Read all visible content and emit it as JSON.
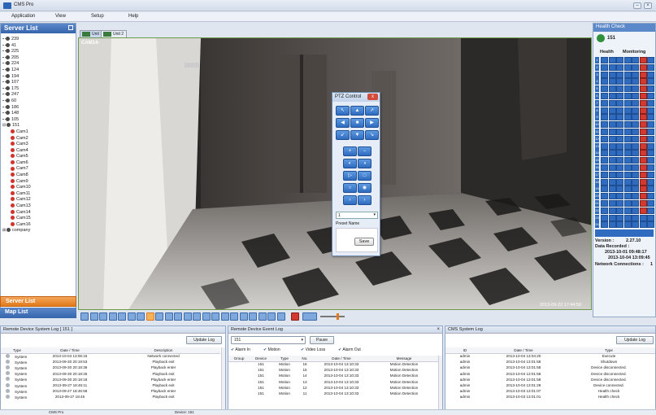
{
  "window": {
    "title": "CMS Pro"
  },
  "menu": [
    "Application",
    "View",
    "Setup",
    "Help"
  ],
  "server_panel": {
    "title": "Server List",
    "servers_top": [
      "239",
      "41",
      "225",
      "205",
      "224",
      "124",
      "194",
      "107",
      "175",
      "247",
      "60",
      "186",
      "148",
      "105"
    ],
    "open_server": "151",
    "cameras": [
      "Cam1",
      "Cam2",
      "Cam3",
      "Cam4",
      "Cam5",
      "Cam6",
      "Cam7",
      "Cam8",
      "Cam9",
      "Cam10",
      "Cam11",
      "Cam12",
      "Cam13",
      "Cam14",
      "Cam15",
      "Cam16"
    ],
    "group": "company",
    "bottom_tabs": {
      "server_list": "Server List",
      "map_list": "Map List"
    }
  },
  "video": {
    "tabs": [
      "Unit 1",
      "Unit 2"
    ],
    "camera_label": "CAM14-",
    "timestamp": "2013-09-22 17:44:59"
  },
  "ptz": {
    "title": "PTZ Control",
    "close": "x",
    "select_value": "1",
    "preset_label": "Preset Name",
    "save_label": "Save"
  },
  "health": {
    "title": "Health Check",
    "unit": "151",
    "columns": [
      "Health",
      "Monitoring"
    ],
    "version_label": "Version :",
    "version": "2.27.10",
    "data_recorded_label": "Data Recorded :",
    "data_recorded_from": "2013-10-01 09:48:17",
    "data_recorded_to": "2013-10-04 13:09:45",
    "network_label": "Network Connections :",
    "network_value": "1"
  },
  "device_log": {
    "title": "Remote Device System Log [ 151 ]",
    "button": "Update Log",
    "columns": [
      "Type",
      "Date / Time",
      "Description"
    ],
    "rows": [
      [
        "System",
        "2013-10-04 13:06:15",
        "Network connected"
      ],
      [
        "System",
        "2013-09-30 20:19:53",
        "Playback exit"
      ],
      [
        "System",
        "2013-09-30 20:18:36",
        "Playback enter"
      ],
      [
        "System",
        "2013-09-30 20:18:25",
        "Playback exit"
      ],
      [
        "System",
        "2013-09-30 20:18:18",
        "Playback enter"
      ],
      [
        "System",
        "2013-09-27 18:46:11",
        "Playback exit"
      ],
      [
        "System",
        "2013-09-27 18:45:58",
        "Playback enter"
      ],
      [
        "System",
        "2013-09-27 18:45",
        "Playback exit"
      ]
    ]
  },
  "event_log": {
    "title": "Remote Device Event Log",
    "select_value": "151",
    "pause": "Pause",
    "filters": [
      "Alarm In",
      "Motion",
      "Video Loss",
      "Alarm Out"
    ],
    "columns": [
      "Group",
      "Device",
      "Type",
      "No.",
      "Date / Time",
      "Message"
    ],
    "rows": [
      [
        "",
        "151",
        "Motion",
        "16",
        "2013-10-04 13:10:33",
        "Motion Detection"
      ],
      [
        "",
        "151",
        "Motion",
        "15",
        "2013-10-04 13:10:33",
        "Motion Detection"
      ],
      [
        "",
        "151",
        "Motion",
        "14",
        "2013-10-04 13:10:33",
        "Motion Detection"
      ],
      [
        "",
        "151",
        "Motion",
        "13",
        "2013-10-04 13:10:33",
        "Motion Detection"
      ],
      [
        "",
        "151",
        "Motion",
        "12",
        "2013-10-04 13:10:33",
        "Motion Detection"
      ],
      [
        "",
        "151",
        "Motion",
        "11",
        "2013-10-04 13:10:33",
        "Motion Detection"
      ]
    ]
  },
  "cms_log": {
    "title": "CMS System Log",
    "button": "Update Log",
    "columns": [
      "ID",
      "Date / Time",
      "Type"
    ],
    "rows": [
      [
        "admin",
        "2013-10-04 13:04:20",
        "Execute"
      ],
      [
        "admin",
        "2013-10-04 13:01:58",
        "Shutdown"
      ],
      [
        "admin",
        "2013-10-04 13:01:58",
        "Device disconnected."
      ],
      [
        "admin",
        "2013-10-04 13:01:58",
        "Device disconnected."
      ],
      [
        "admin",
        "2013-10-04 13:01:58",
        "Device disconnected."
      ],
      [
        "admin",
        "2013-10-04 13:01:28",
        "Device connected."
      ],
      [
        "admin",
        "2013-10-03 13:01:07",
        "Health check"
      ],
      [
        "admin",
        "2013-10-03 13:01:01",
        "Health check"
      ]
    ]
  },
  "status": {
    "left": "CMS Pro",
    "middle": "Device: 151"
  },
  "colors": {
    "accent": "#3565ad",
    "highlight": "#e07a1c",
    "alarm": "#d23a2f",
    "video_border": "#6a9a4a"
  }
}
